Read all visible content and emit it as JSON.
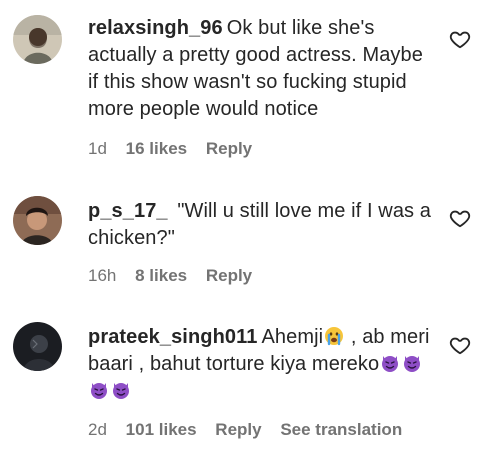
{
  "comments": [
    {
      "username": "relaxsingh_96",
      "text": "Ok but like she's actually a pretty good actress. Maybe if this show wasn't so fucking stupid more people would notice",
      "time": "1d",
      "likes": "16 likes",
      "reply": "Reply",
      "avatar_icon": "user-avatar"
    },
    {
      "username": "p_s_17_",
      "text": "\"Will u still love me if I was a chicken?\"",
      "time": "16h",
      "likes": "8 likes",
      "reply": "Reply",
      "avatar_icon": "user-avatar"
    },
    {
      "username": "prateek_singh011",
      "text_before_emoji": "Ahemji",
      "text_after_emoji": " , ab meri baari , bahut torture kiya mereko",
      "emoji_inline": "crying-face-emoji",
      "emoji_trailing": [
        "purple-devil-emoji",
        "purple-devil-emoji",
        "purple-devil-emoji",
        "purple-devil-emoji"
      ],
      "time": "2d",
      "likes": "101 likes",
      "reply": "Reply",
      "see_translation": "See translation",
      "avatar_icon": "user-avatar"
    }
  ],
  "icons": {
    "like": "heart-outline-icon"
  },
  "colors": {
    "text": "#262626",
    "meta": "#737373",
    "background": "#ffffff",
    "devil_emoji": "#8e4ec6"
  }
}
